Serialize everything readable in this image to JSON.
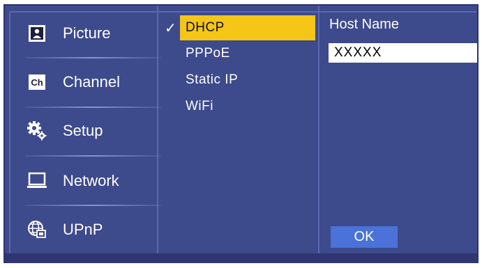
{
  "sidebar": {
    "items": [
      {
        "label": "Picture",
        "icon": "picture-icon"
      },
      {
        "label": "Channel",
        "icon": "channel-icon"
      },
      {
        "label": "Setup",
        "icon": "setup-gears-icon"
      },
      {
        "label": "Network",
        "icon": "laptop-network-icon"
      },
      {
        "label": "UPnP",
        "icon": "globe-network-icon"
      }
    ],
    "channel_icon_text": "Ch"
  },
  "network_modes": {
    "selected_index": 0,
    "check_mark": "✓",
    "items": [
      "DHCP",
      "PPPoE",
      "Static IP",
      "WiFi"
    ]
  },
  "host": {
    "label": "Host Name",
    "value": "XXXXX"
  },
  "ok_label": "OK",
  "colors": {
    "panel_bg": "#3d4a8c",
    "selection": "#f5c518",
    "ok_button": "#4a72d8"
  }
}
